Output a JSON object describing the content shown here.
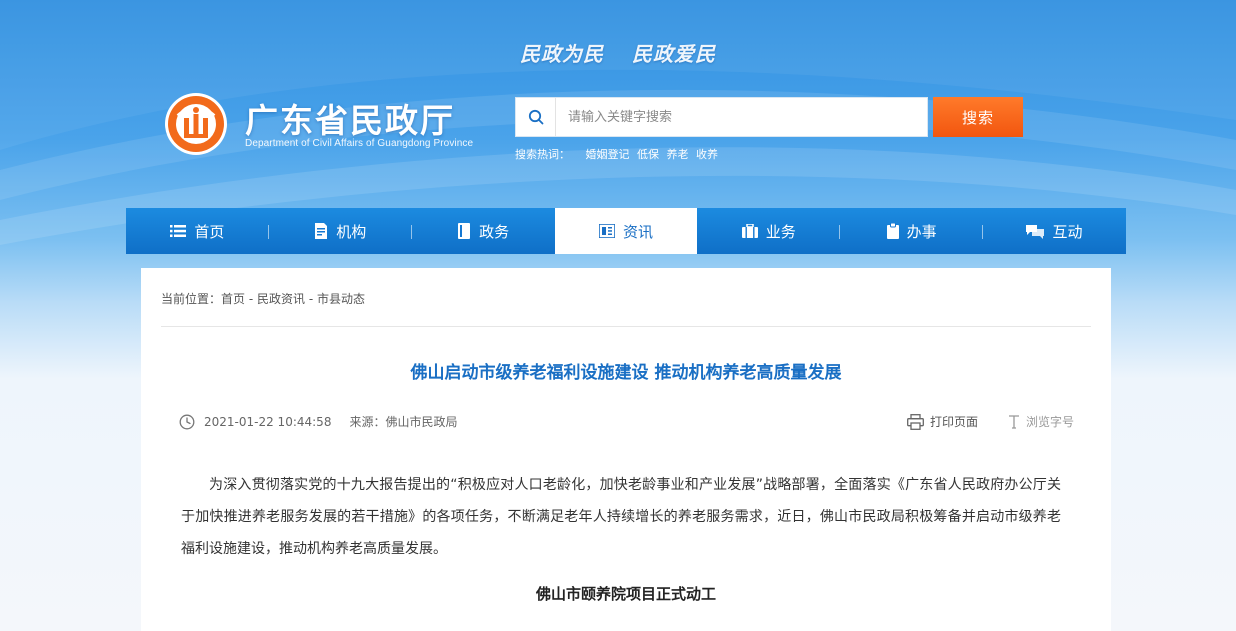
{
  "header": {
    "slogans": [
      "民政为民",
      "民政爱民"
    ],
    "site_title": "广东省民政厅",
    "site_subtitle": "Department of Civil Affairs of Guangdong Province",
    "logo_icon": "civil-affairs-emblem-icon"
  },
  "search": {
    "placeholder": "请输入关键字搜索",
    "value": "",
    "button_label": "搜索",
    "hot_label": "搜索热词：",
    "hot_words": [
      "婚姻登记",
      "低保",
      "养老",
      "收养"
    ]
  },
  "nav": {
    "items": [
      {
        "label": "首页",
        "icon": "list-icon"
      },
      {
        "label": "机构",
        "icon": "document-icon"
      },
      {
        "label": "政务",
        "icon": "book-icon"
      },
      {
        "label": "资讯",
        "icon": "news-icon",
        "active": true
      },
      {
        "label": "业务",
        "icon": "briefcase-icon"
      },
      {
        "label": "办事",
        "icon": "clipboard-icon"
      },
      {
        "label": "互动",
        "icon": "chat-icon"
      }
    ]
  },
  "breadcrumb": {
    "prefix": "当前位置：",
    "items": [
      "首页",
      "民政资讯",
      "市县动态"
    ],
    "separator": " - "
  },
  "article": {
    "title": "佛山启动市级养老福利设施建设 推动机构养老高质量发展",
    "datetime": "2021-01-22 10:44:58",
    "source": "来源：佛山市民政局",
    "print_label": "打印页面",
    "font_size_label": "浏览字号",
    "paragraph": "为深入贯彻落实党的十九大报告提出的“积极应对人口老龄化，加快老龄事业和产业发展”战略部署，全面落实《广东省人民政府办公厅关于加快推进养老服务发展的若干措施》的各项任务，不断满足老年人持续增长的养老服务需求，近日，佛山市民政局积极筹备并启动市级养老福利设施建设，推动机构养老高质量发展。",
    "subheading": "佛山市颐养院项目正式动工"
  },
  "colors": {
    "nav_bg": "#1578d2",
    "accent_blue": "#1a6fc4",
    "search_button": "#f5631a"
  }
}
